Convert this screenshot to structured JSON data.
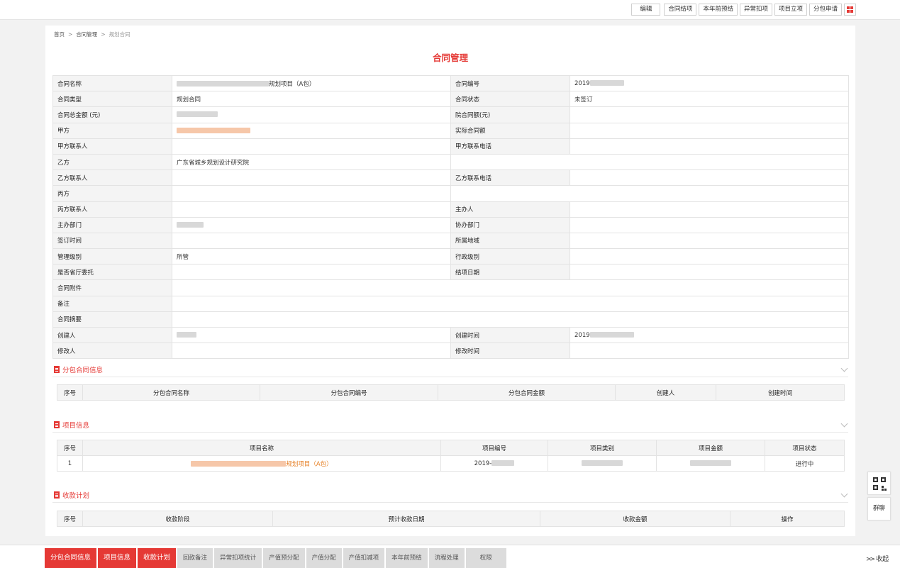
{
  "toolbar": {
    "buttons": [
      "编辑",
      "合同结项",
      "本年前预结",
      "异常扣项",
      "项目立项",
      "分包申请"
    ],
    "grid_icon": "grid-menu-icon",
    "accent": "#e53935"
  },
  "breadcrumb": {
    "home": "首页",
    "sep": ">",
    "level2": "合同管理",
    "current": "规划合同"
  },
  "page_title": "合同管理",
  "contract": {
    "r1": {
      "l1": "合同名称",
      "v1": "规划项目（A包）",
      "l2": "合同编号",
      "v2": "2019"
    },
    "r2": {
      "l1": "合同类型",
      "v1": "规划合同",
      "l2": "合同状态",
      "v2": "未签订"
    },
    "r3": {
      "l1": "合同总金额 (元)",
      "v1": "",
      "l2": "院合同额(元)",
      "v2": ""
    },
    "r4": {
      "l1": "甲方",
      "v1": "",
      "l2": "实际合同额",
      "v2": ""
    },
    "r5": {
      "l1": "甲方联系人",
      "v1": "",
      "l2": "甲方联系电话",
      "v2": ""
    },
    "r6": {
      "l1": "乙方",
      "v1": "广东省城乡规划设计研究院"
    },
    "r7": {
      "l1": "乙方联系人",
      "v1": "",
      "l2": "乙方联系电话",
      "v2": ""
    },
    "r8": {
      "l1": "丙方",
      "v1": ""
    },
    "r9": {
      "l1": "丙方联系人",
      "v1": "",
      "l2": "主办人",
      "v2": ""
    },
    "r10": {
      "l1": "主办部门",
      "v1": "",
      "l2": "协办部门",
      "v2": ""
    },
    "r11": {
      "l1": "签订时间",
      "v1": "",
      "l2": "所属地域",
      "v2": ""
    },
    "r12": {
      "l1": "管理级别",
      "v1": "所管",
      "l2": "行政级别",
      "v2": ""
    },
    "r13": {
      "l1": "是否省厅委托",
      "v1": "",
      "l2": "结项日期",
      "v2": ""
    },
    "r14": {
      "l1": "合同附件",
      "v1": ""
    },
    "r15": {
      "l1": "备注",
      "v1": ""
    },
    "r16": {
      "l1": "合同摘要",
      "v1": ""
    },
    "r17": {
      "l1": "创建人",
      "v1": "",
      "l2": "创建时间",
      "v2": "2019"
    },
    "r18": {
      "l1": "修改人",
      "v1": "",
      "l2": "修改时间",
      "v2": ""
    }
  },
  "sections": {
    "subcontract": {
      "title": "分包合同信息",
      "columns": [
        "序号",
        "分包合同名称",
        "分包合同编号",
        "分包合同金额",
        "创建人",
        "创建时间"
      ]
    },
    "project": {
      "title": "项目信息",
      "columns": [
        "序号",
        "项目名称",
        "项目编号",
        "项目类别",
        "项目金额",
        "项目状态"
      ],
      "rows": [
        {
          "no": "1",
          "name": "规划项目（A包）",
          "code": "2019-",
          "status": "进行中"
        }
      ]
    },
    "payment": {
      "title": "收款计划",
      "columns": [
        "序号",
        "收款阶段",
        "预计收款日期",
        "收款金额",
        "操作"
      ]
    }
  },
  "float_buttons": {
    "qr_label": "qr-code-icon",
    "chat": "群聊"
  },
  "bottom_tabs": [
    "分包合同信息",
    "项目信息",
    "收款计划",
    "回款备注",
    "异常扣项统计",
    "产值预分配",
    "产值分配",
    "产值扣减项",
    "本年前预结",
    "流程处理",
    "权限"
  ],
  "collapse_label": "收起"
}
